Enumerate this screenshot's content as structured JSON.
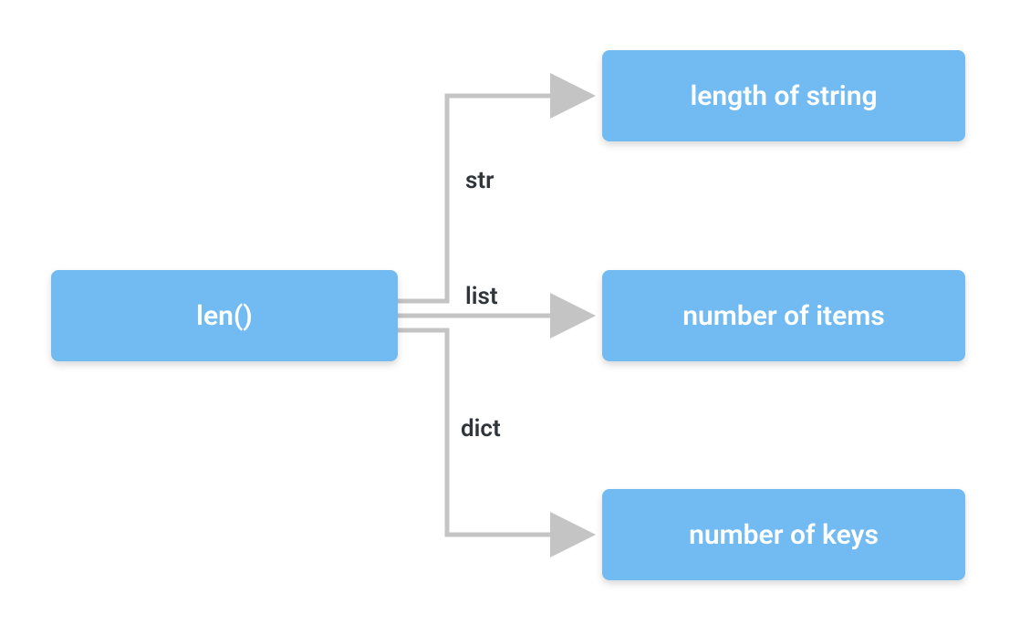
{
  "source": {
    "label": "len()"
  },
  "targets": [
    {
      "label": "length of string",
      "edge_label": "str"
    },
    {
      "label": "number of items",
      "edge_label": "list"
    },
    {
      "label": "number of keys",
      "edge_label": "dict"
    }
  ],
  "colors": {
    "node_fill": "#71bbf2",
    "node_text": "#ffffff",
    "edge_label": "#2f353a",
    "arrow": "#c4c4c4"
  }
}
